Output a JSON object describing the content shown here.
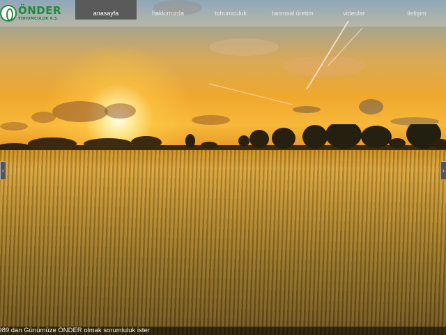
{
  "brand": {
    "name": "ÖNDER",
    "subtitle": "TOHUMCULUK A.Ş.",
    "accent_color": "#1f8a3a"
  },
  "nav": {
    "items": [
      {
        "label": "anasayfa",
        "active": true
      },
      {
        "label": "hakkımızda",
        "active": false
      },
      {
        "label": "tohumculuk",
        "active": false
      },
      {
        "label": "tarımsal üretim",
        "active": false
      },
      {
        "label": "videolar",
        "active": false
      },
      {
        "label": "iletişim",
        "active": false
      }
    ]
  },
  "slider": {
    "prev_icon": "chevron-left-icon",
    "next_icon": "chevron-right-icon",
    "caption": "1989 dan Günümüze ÖNDER olmak sorumluluk ister"
  }
}
